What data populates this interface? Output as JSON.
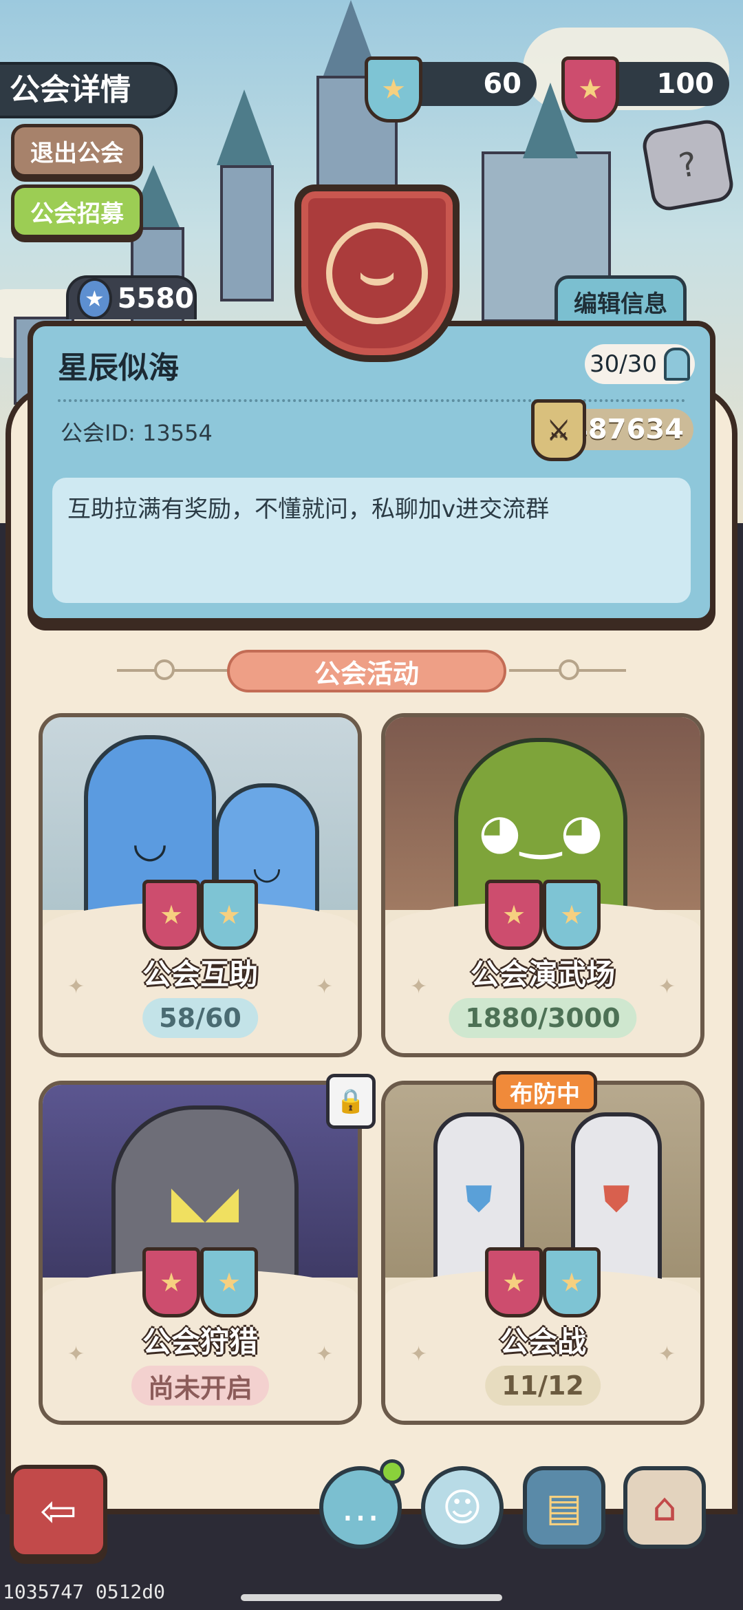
{
  "header": {
    "title": "公会详情",
    "exit_label": "退出公会",
    "recruit_label": "公会招募"
  },
  "currency": {
    "blue_badge_count": "60",
    "red_badge_count": "100"
  },
  "guild": {
    "stars": "5580",
    "edit_label": "编辑信息",
    "name": "星辰似海",
    "members": "30/30",
    "id_text": "公会ID: 13554",
    "power": "487634",
    "notice": "互助拉满有奖励，不懂就问，私聊加v进交流群"
  },
  "activities": {
    "header": "公会活动",
    "items": [
      {
        "title": "公会互助",
        "status": "58/60"
      },
      {
        "title": "公会演武场",
        "status": "1880/3000"
      },
      {
        "title": "公会狩猎",
        "status": "尚未开启"
      },
      {
        "title": "公会战",
        "status": "11/12",
        "badge": "布防中"
      }
    ]
  },
  "footer": {
    "debug_id": "1035747 0512d0"
  },
  "colors": {
    "panel": "#f5ead7",
    "card_blue": "#8ec7da",
    "accent_red": "#cd4d6e",
    "accent_teal": "#7ec4d4",
    "header_orange": "#ee9f86"
  },
  "icons": [
    "back-arrow-icon",
    "chat-icon",
    "friends-icon",
    "codex-book-icon",
    "shop-icon",
    "dice-icon",
    "lock-icon",
    "star-icon",
    "person-icon",
    "power-icon"
  ]
}
